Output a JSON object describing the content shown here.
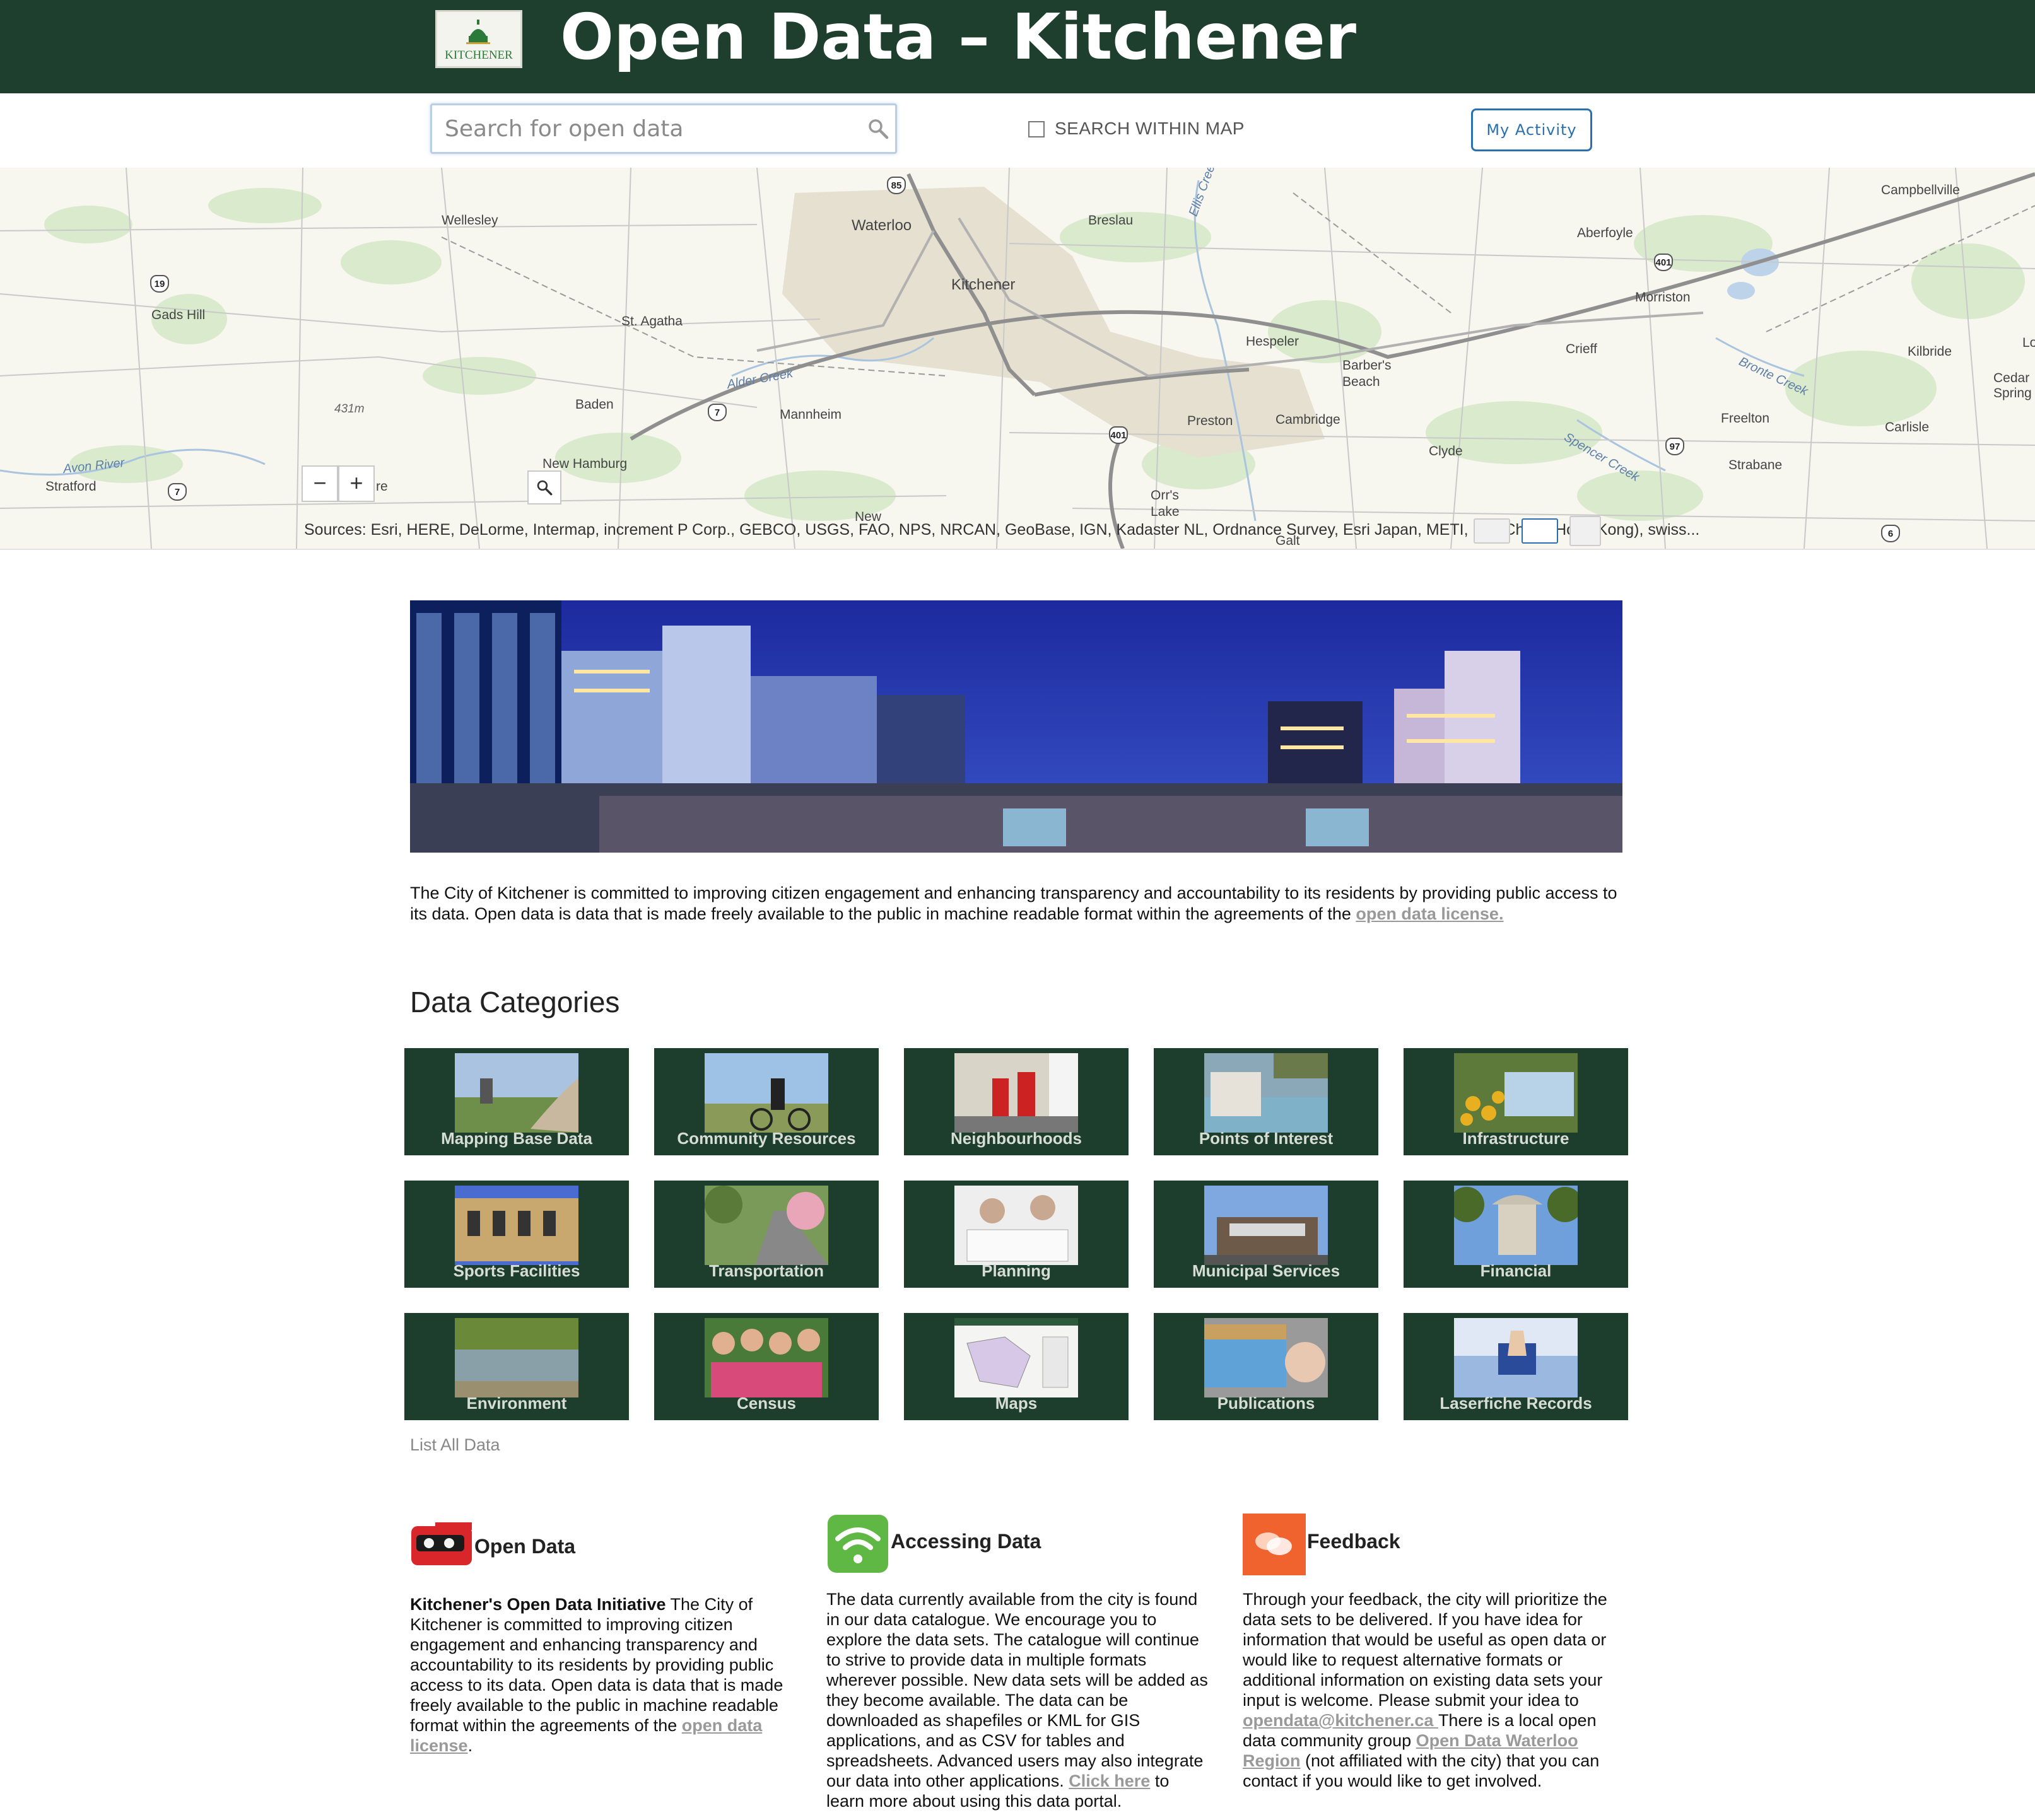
{
  "header": {
    "logo_text": "KITCHENER",
    "title": "Open Data – Kitchener"
  },
  "toolbar": {
    "search_placeholder": "Search for open data",
    "search_within_map_label": "SEARCH WITHIN MAP",
    "my_activity_label": "My Activity"
  },
  "map": {
    "places": [
      {
        "label": "Wellesley"
      },
      {
        "label": "Waterloo"
      },
      {
        "label": "Breslau"
      },
      {
        "label": "Kitchener"
      },
      {
        "label": "Gads Hill"
      },
      {
        "label": "St. Agatha"
      },
      {
        "label": "Hespeler"
      },
      {
        "label": "Barber's"
      },
      {
        "label": "Beach"
      },
      {
        "label": "Baden"
      },
      {
        "label": "Mannheim"
      },
      {
        "label": "Preston"
      },
      {
        "label": "Cambridge"
      },
      {
        "label": "Clyde"
      },
      {
        "label": "Stratford"
      },
      {
        "label": "New Hamburg"
      },
      {
        "label": "Orr's"
      },
      {
        "label": "Lake"
      },
      {
        "label": "New"
      },
      {
        "label": "Campbellville"
      },
      {
        "label": "Aberfoyle"
      },
      {
        "label": "Morriston"
      },
      {
        "label": "Crieff"
      },
      {
        "label": "Kilbride"
      },
      {
        "label": "Cedar"
      },
      {
        "label": "Spring"
      },
      {
        "label": "Freelton"
      },
      {
        "label": "Carlisle"
      },
      {
        "label": "Strabane"
      },
      {
        "label": "Lo"
      },
      {
        "label": "Galt"
      },
      {
        "label": "re"
      }
    ],
    "water_labels": [
      "Avon River",
      "Alder Creek",
      "Spencer Creek",
      "Bronte Creek",
      "Ellis Creek"
    ],
    "elevation_label": "431m",
    "highways": [
      "85",
      "19",
      "7",
      "401",
      "7",
      "97",
      "401",
      "6"
    ],
    "zoom_out": "−",
    "zoom_in": "+",
    "attribution": "Sources: Esri, HERE, DeLorme, Intermap, increment P Corp., GEBCO, USGS, FAO, NPS, NRCAN, GeoBase, IGN, Kadaster NL, Ordnance Survey, Esri Japan, METI, Esri China (Hong Kong), swiss..."
  },
  "intro": {
    "text": "The City of Kitchener is committed to improving citizen engagement and enhancing transparency and accountability to its residents by providing public access to its data. Open data is data that is made freely available to the public in machine readable format within the agreements of the ",
    "link": "open data license."
  },
  "categories": {
    "heading": "Data Categories",
    "items": [
      {
        "label": "Mapping Base Data"
      },
      {
        "label": "Community Resources"
      },
      {
        "label": "Neighbourhoods"
      },
      {
        "label": "Points of Interest"
      },
      {
        "label": "Infrastructure"
      },
      {
        "label": "Sports Facilities"
      },
      {
        "label": "Transportation"
      },
      {
        "label": "Planning"
      },
      {
        "label": "Municipal Services"
      },
      {
        "label": "Financial"
      },
      {
        "label": "Environment"
      },
      {
        "label": "Census"
      },
      {
        "label": "Maps"
      },
      {
        "label": "Publications"
      },
      {
        "label": "Laserfiche Records"
      }
    ],
    "list_all": "List All Data"
  },
  "info": {
    "open_data": {
      "title": "Open Data",
      "bold": "Kitchener's Open Data Initiative",
      "text": " The City of Kitchener is committed to improving citizen engagement and enhancing transparency and accountability to its residents by providing public access to its data. Open data is data that is made freely available to the public in machine readable format within the agreements of the ",
      "link": "open data license",
      "end": "."
    },
    "accessing": {
      "title": "Accessing Data",
      "text": "The data currently available from the city is found in our data catalogue. We encourage you to explore the data sets. The catalogue will continue to strive to provide data in multiple formats wherever possible. New data sets will be added as they become available. The data can be downloaded as shapefiles or KML for GIS applications, and as CSV for tables and spreadsheets. Advanced users may also integrate our data into other applications. ",
      "link": "Click here",
      "end": " to learn more about using this data portal."
    },
    "feedback": {
      "title": "Feedback",
      "text": "Through your feedback, the city will prioritize the data sets to be delivered. If you have idea for information that would be useful as open data or would like to request alternative formats or additional information on existing data sets your input is welcome. Please submit your idea to ",
      "email": "opendata@kitchener.ca ",
      "text2": "There is a local open data community group ",
      "group_link": "Open Data Waterloo Region",
      "end": " (not affiliated with the city) that you can contact if you would like to get involved."
    }
  },
  "colors": {
    "header_bg": "#1e3f2d",
    "tile_bg": "#1d3e2c",
    "button_accent": "#2a6fb0",
    "link_gray": "#999999"
  }
}
